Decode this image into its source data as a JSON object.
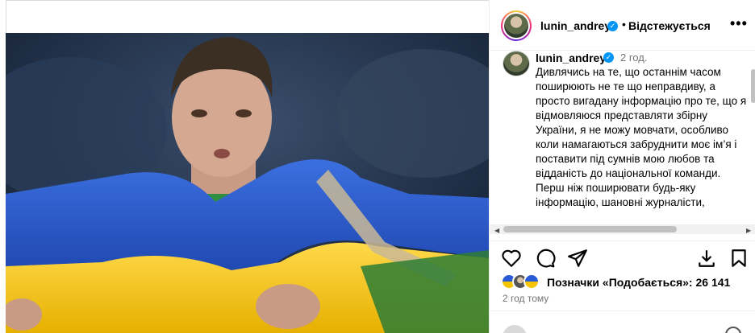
{
  "header": {
    "username": "lunin_andrey",
    "separator": "•",
    "follow_status": "Відстежується",
    "more_label": "•••"
  },
  "caption": {
    "username": "lunin_andrey",
    "time": "2 год.",
    "paragraph1": "Дивлячись на те, що останнім часом поширюють не те що неправдиву, а просто вигадану інформацію про те, що я відмовляюся представляти збірну України, я не можу мовчати, особливо коли намагаються забруднити моє ім’я і поставити під сумнів мою любов та відданість до національної команди.",
    "paragraph2": "Перш ніж поширювати будь-яку інформацію, шановні журналісти,"
  },
  "likes": {
    "text": "Позначки «Подобається»: 26 141"
  },
  "posted_ago": "2 год тому",
  "icons": {
    "like": "heart-icon",
    "comment": "comment-icon",
    "share": "share-icon",
    "save": "bookmark-icon",
    "download": "download-icon",
    "verified": "verified-badge-icon",
    "more": "more-options-icon"
  },
  "colors": {
    "verified_blue": "#0095f6",
    "flag_blue": "#2a5bd7",
    "flag_yellow": "#f5c400",
    "secondary_text": "#737373"
  }
}
